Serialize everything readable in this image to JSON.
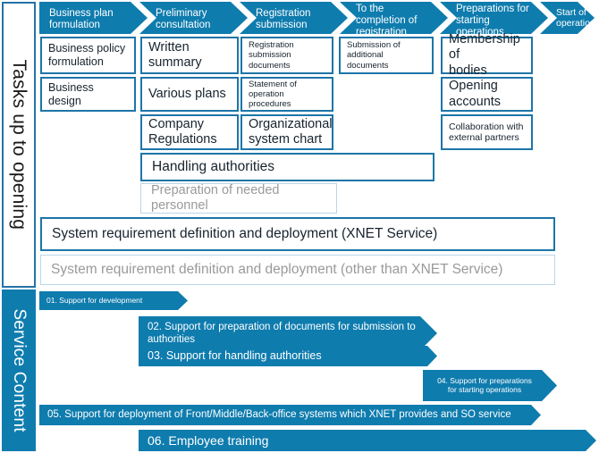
{
  "colors": {
    "brand_blue": "#0f7cae",
    "box_border": "#1d75a8",
    "ghost_border": "#b9d6e8",
    "ghost_text": "#9a9a9a",
    "text": "#17232e",
    "white": "#ffffff"
  },
  "rails": {
    "tasks_label": "Tasks up to opening",
    "service_label": "Service Content"
  },
  "phases": [
    {
      "label": "Business plan\nformulation"
    },
    {
      "label": "Preliminary\nconsultation"
    },
    {
      "label": "Registration\nsubmission"
    },
    {
      "label": "To the\ncompletion of\nregistration"
    },
    {
      "label": "Preparations for\nstarting\noperations"
    },
    {
      "label": "Start of\noperations"
    }
  ],
  "task_boxes": [
    {
      "label": "Business policy\nformulation"
    },
    {
      "label": "Written summary"
    },
    {
      "label": "Registration\nsubmission\ndocuments"
    },
    {
      "label": "Submission of\nadditional documents"
    },
    {
      "label": "Membership of\nbodies"
    },
    {
      "label": "Business design"
    },
    {
      "label": "Various plans"
    },
    {
      "label": "Statement of\noperation procedures"
    },
    {
      "label": "Opening\naccounts"
    },
    {
      "label": "Company\nRegulations"
    },
    {
      "label": "Organizational\nsystem chart"
    },
    {
      "label": "Collaboration with\nexternal partners"
    },
    {
      "label": "Handling authorities"
    },
    {
      "label": "Preparation of needed personnel"
    },
    {
      "label": "System requirement definition and deployment (XNET Service)"
    },
    {
      "label": "System requirement definition and deployment (other than XNET Service)"
    }
  ],
  "service_arrows": [
    {
      "label": "01. Support for development"
    },
    {
      "label": "02. Support for preparation of documents for submission to\n     authorities"
    },
    {
      "label": "03. Support for handling authorities"
    },
    {
      "label": "04. Support for preparations\nfor starting operations"
    },
    {
      "label": "05. Support for deployment of Front/Middle/Back-office systems which XNET provides and SO service"
    },
    {
      "label": "06. Employee training"
    }
  ]
}
